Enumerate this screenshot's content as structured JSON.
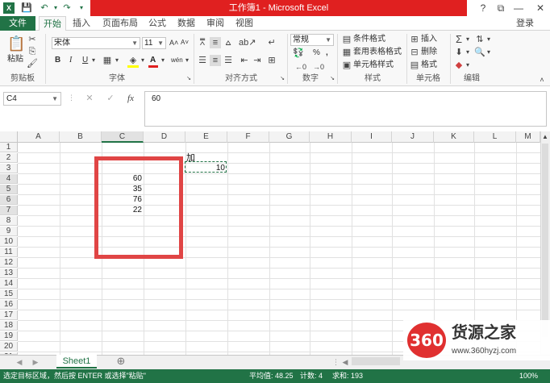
{
  "window": {
    "title": "工作簿1 - Microsoft Excel",
    "help": "?",
    "restore": "⧉",
    "minimize": "—",
    "maximize": "□",
    "close": "✕",
    "signin": "登录"
  },
  "quick_access": [
    "save-icon",
    "undo-icon",
    "redo-icon",
    "customize-icon"
  ],
  "tabs": [
    "文件",
    "开始",
    "插入",
    "页面布局",
    "公式",
    "数据",
    "审阅",
    "视图"
  ],
  "ribbon": {
    "clipboard": {
      "paste": "粘贴",
      "label": "剪贴板"
    },
    "font": {
      "name": "宋体",
      "size": "11",
      "bold": "B",
      "italic": "I",
      "underline": "U",
      "grow": "A˄",
      "shrink": "A˅",
      "color_a": "A",
      "wen": "wén",
      "label": "字体"
    },
    "alignment": {
      "label": "对齐方式"
    },
    "number": {
      "format": "常规",
      "percent": "%",
      "comma": ",",
      "label": "数字"
    },
    "styles": {
      "conditional": "条件格式",
      "table": "套用表格格式",
      "cell": "单元格样式",
      "label": "样式"
    },
    "cells": {
      "insert": "插入",
      "delete": "删除",
      "format": "格式",
      "label": "单元格"
    },
    "editing": {
      "label": "编辑"
    }
  },
  "formula_bar": {
    "namebox": "C4",
    "cancel": "✕",
    "enter": "✓",
    "fx": "fx",
    "value": "60"
  },
  "columns": [
    "A",
    "B",
    "C",
    "D",
    "E",
    "F",
    "G",
    "H",
    "I",
    "J",
    "K",
    "L",
    "M"
  ],
  "rows": [
    "1",
    "2",
    "3",
    "4",
    "5",
    "6",
    "7",
    "8",
    "9",
    "10",
    "11",
    "12",
    "13",
    "14",
    "15",
    "16",
    "17",
    "18",
    "19",
    "20",
    "21"
  ],
  "cells": {
    "E2": "加",
    "E3": "10",
    "C4": "60",
    "C5": "35",
    "C6": "76",
    "C7": "22"
  },
  "sheets": {
    "active": "Sheet1",
    "add": "⊕"
  },
  "status": {
    "message": "选定目标区域，然后按 ENTER 或选择\"粘贴\"",
    "average": "平均值: 48.25",
    "count": "计数: 4",
    "sum": "求和: 193",
    "zoom": "100%"
  },
  "watermark": {
    "logo": "360",
    "name": "货源之家",
    "url": "www.360hyzj.com"
  }
}
